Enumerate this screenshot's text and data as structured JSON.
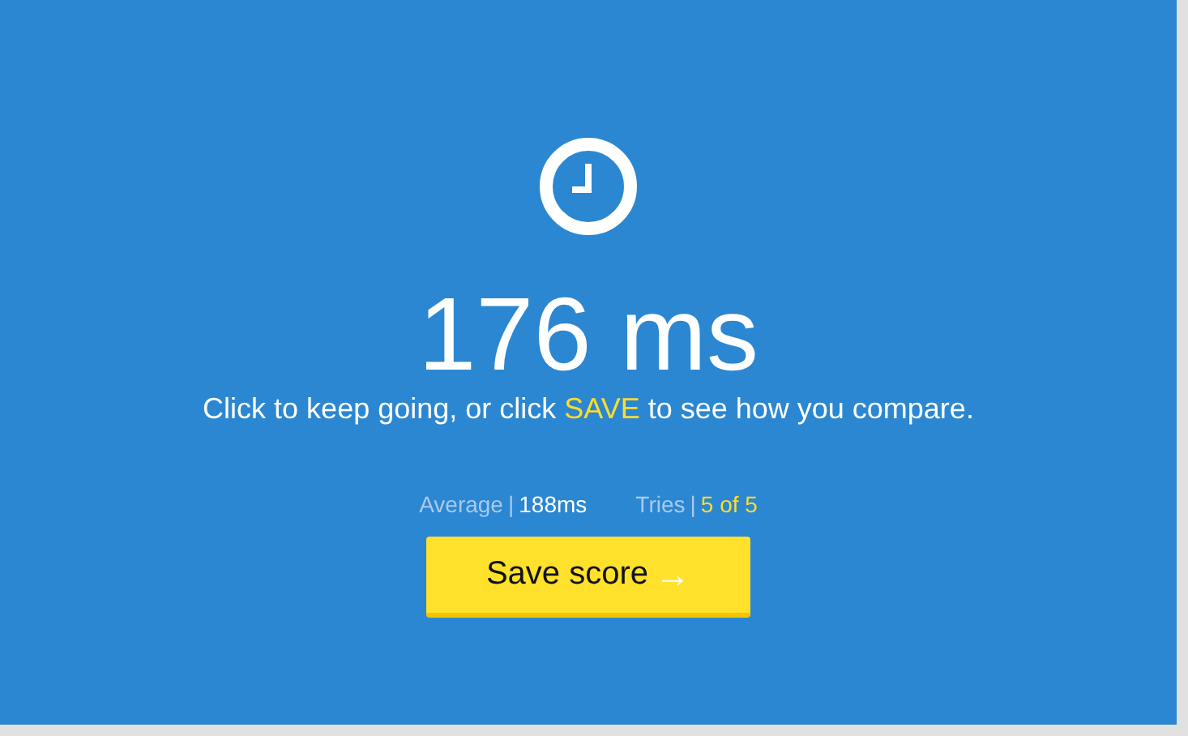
{
  "result": {
    "time": "176 ms"
  },
  "message": {
    "before": "Click to keep going, or click ",
    "highlight": "SAVE",
    "after": " to see how you compare."
  },
  "stats": [
    {
      "label": "Average",
      "separator": "|",
      "value": "188ms",
      "highlighted": false
    },
    {
      "label": "Tries",
      "separator": "|",
      "value": "5 of 5",
      "highlighted": true
    }
  ],
  "button": {
    "label": "Save score",
    "icon": "→"
  }
}
